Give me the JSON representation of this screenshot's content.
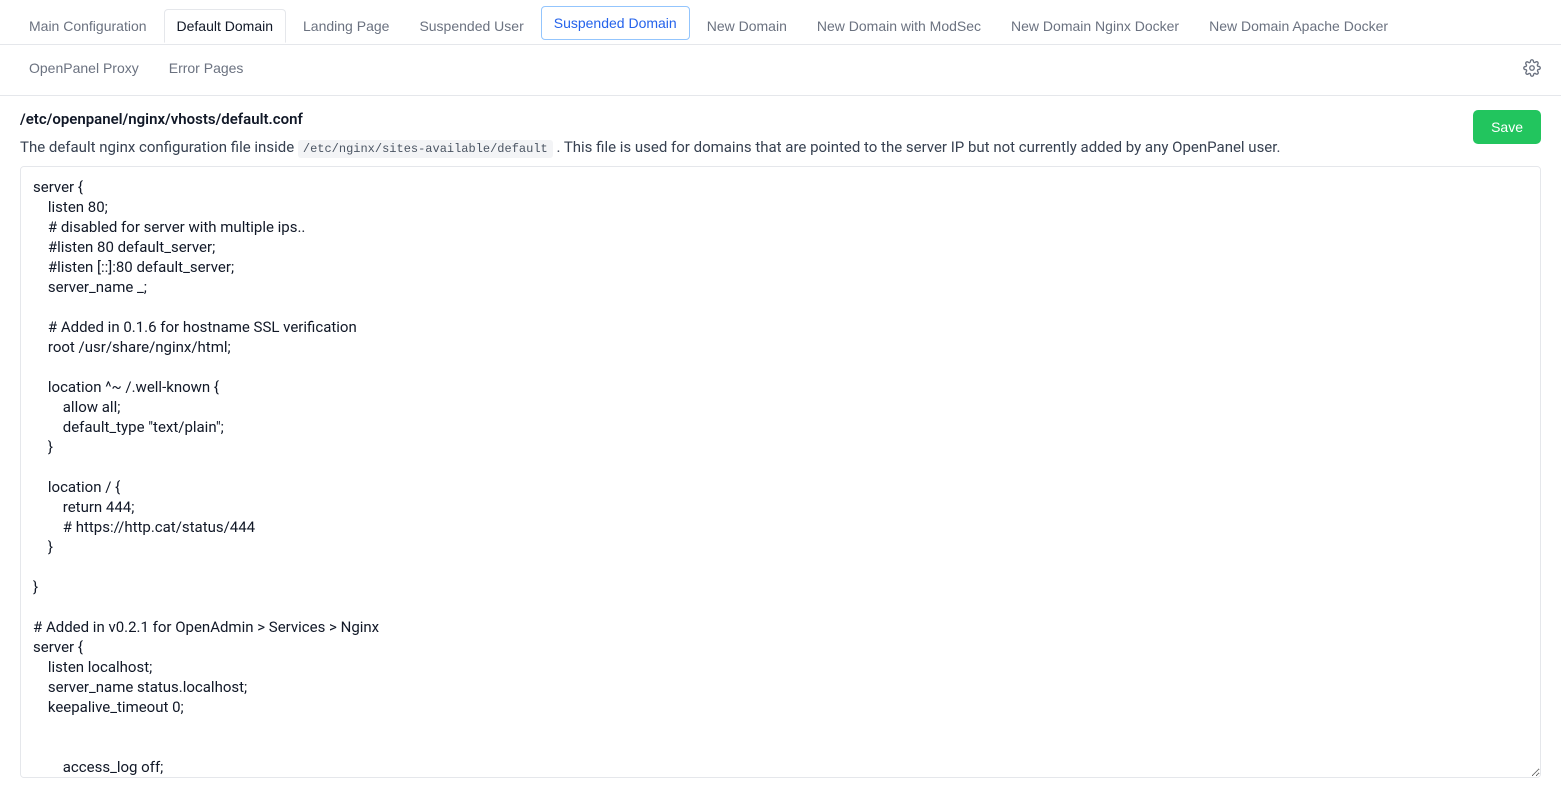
{
  "tabs_row1": [
    {
      "label": "Main Configuration",
      "state": "normal"
    },
    {
      "label": "Default Domain",
      "state": "active"
    },
    {
      "label": "Landing Page",
      "state": "normal"
    },
    {
      "label": "Suspended User",
      "state": "normal"
    },
    {
      "label": "Suspended Domain",
      "state": "highlighted"
    },
    {
      "label": "New Domain",
      "state": "normal"
    },
    {
      "label": "New Domain with ModSec",
      "state": "normal"
    },
    {
      "label": "New Domain Nginx Docker",
      "state": "normal"
    },
    {
      "label": "New Domain Apache Docker",
      "state": "normal"
    }
  ],
  "tabs_row2": [
    {
      "label": "OpenPanel Proxy",
      "state": "normal"
    },
    {
      "label": "Error Pages",
      "state": "normal"
    }
  ],
  "file_path": "/etc/openpanel/nginx/vhosts/default.conf",
  "description_prefix": "The default nginx configuration file inside ",
  "description_code": "/etc/nginx/sites-available/default",
  "description_suffix": " . This file is used for domains that are pointed to the server IP but not currently added by any OpenPanel user.",
  "save_label": "Save",
  "editor_content": "server {\n    listen 80;\n    # disabled for server with multiple ips..\n    #listen 80 default_server;\n    #listen [::]:80 default_server;\n    server_name _;\n\n    # Added in 0.1.6 for hostname SSL verification\n    root /usr/share/nginx/html;\n\n    location ^~ /.well-known {\n        allow all;\n        default_type \"text/plain\";\n    }\n\n    location / {\n        return 444;\n        # https://http.cat/status/444\n    }\n\n}\n\n# Added in v0.2.1 for OpenAdmin > Services > Nginx\nserver {\n    listen localhost;\n    server_name status.localhost;\n    keepalive_timeout 0;\n\n\n        access_log off;\n        error_log /dev/null;\n"
}
